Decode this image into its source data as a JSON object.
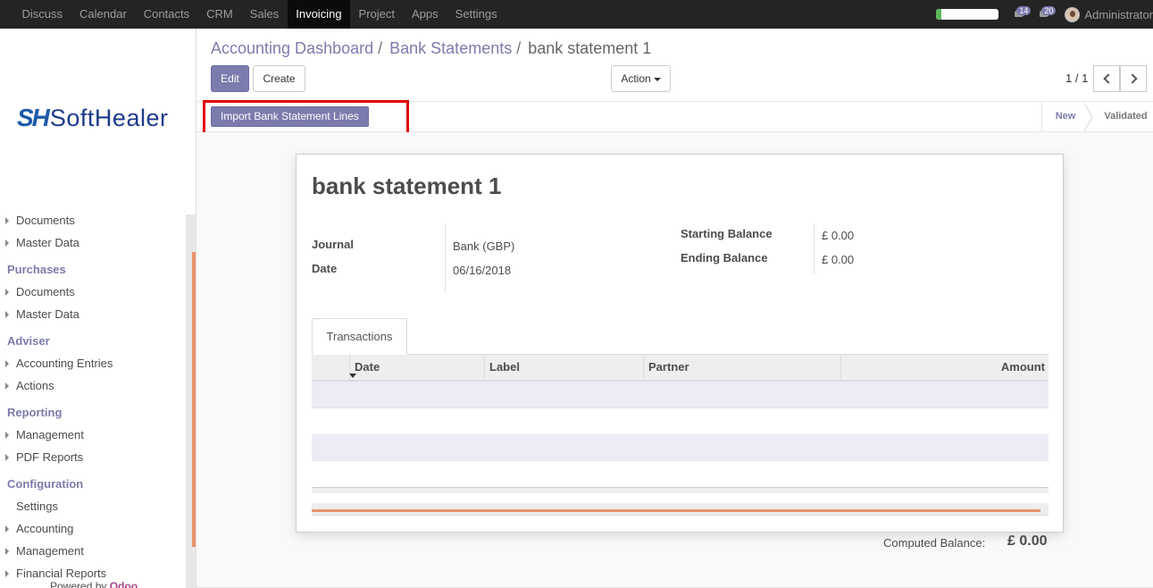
{
  "navbar": {
    "items": [
      "Discuss",
      "Calendar",
      "Contacts",
      "CRM",
      "Sales",
      "Invoicing",
      "Project",
      "Apps",
      "Settings"
    ],
    "active_index": 5,
    "progress_fraction": 0.08,
    "progress_color": "#5cb85c",
    "badges": {
      "activity": "14",
      "messages": "20"
    },
    "user": "Administrator"
  },
  "sidebar": {
    "logo": {
      "mark": "SH",
      "text": "SoftHealer"
    },
    "groups": [
      {
        "header": "",
        "items": [
          "Documents",
          "Master Data"
        ]
      },
      {
        "header": "Purchases",
        "items": [
          "Documents",
          "Master Data"
        ]
      },
      {
        "header": "Adviser",
        "items": [
          "Accounting Entries",
          "Actions"
        ]
      },
      {
        "header": "Reporting",
        "items": [
          "Management",
          "PDF Reports"
        ]
      },
      {
        "header": "Configuration",
        "items": [
          "Settings",
          "Accounting",
          "Management",
          "Financial Reports"
        ]
      }
    ],
    "powered_prefix": "Powered by ",
    "powered_brand": "Odoo"
  },
  "breadcrumb": {
    "items": [
      "Accounting Dashboard",
      "Bank Statements"
    ],
    "current": "bank statement 1",
    "separator": "/"
  },
  "buttons": {
    "edit": "Edit",
    "create": "Create",
    "action": "Action",
    "import": "Import Bank Statement Lines"
  },
  "pager": {
    "value": "1 / 1"
  },
  "statusbar": {
    "stages": [
      "New",
      "Validated"
    ],
    "active": "New"
  },
  "form": {
    "title": "bank statement 1",
    "journal_label": "Journal",
    "journal_value": "Bank (GBP)",
    "date_label": "Date",
    "date_value": "06/16/2018",
    "start_label": "Starting Balance",
    "start_value": "£ 0.00",
    "end_label": "Ending Balance",
    "end_value": "£ 0.00",
    "tab": "Transactions",
    "columns": [
      "Date",
      "Label",
      "Partner",
      "Amount"
    ],
    "computed_label": "Computed Balance:",
    "computed_value": "£ 0.00"
  },
  "colors": {
    "accent": "#7c7bad",
    "navbar": "#242424",
    "highlight": "#e00000",
    "orange": "#e9926a"
  }
}
